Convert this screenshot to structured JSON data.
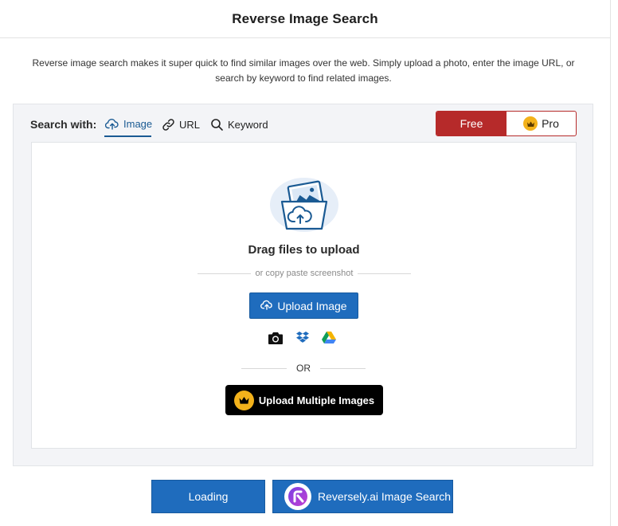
{
  "header": {
    "title": "Reverse Image Search"
  },
  "intro": {
    "text": "Reverse image search makes it super quick to find similar images over the web. Simply upload a photo, enter the image URL, or search by keyword to find related images."
  },
  "search": {
    "label": "Search with:",
    "tabs": [
      {
        "label": "Image",
        "icon": "cloud-upload-icon",
        "active": true
      },
      {
        "label": "URL",
        "icon": "link-icon",
        "active": false
      },
      {
        "label": "Keyword",
        "icon": "search-icon",
        "active": false
      }
    ]
  },
  "plan": {
    "free_label": "Free",
    "pro_label": "Pro",
    "active": "Free"
  },
  "upload": {
    "title": "Drag files to upload",
    "paste_hint": "or copy paste screenshot",
    "button_label": "Upload Image",
    "sources": [
      "camera-icon",
      "dropbox-icon",
      "google-drive-icon"
    ],
    "or_label": "OR",
    "multi_label": "Upload Multiple Images"
  },
  "footer": {
    "loading_label": "Loading",
    "reversely_label": "Reversely.ai Image Search"
  },
  "colors": {
    "accent_blue": "#1f6cbd",
    "free_red": "#b62a2a",
    "crown_gold": "#f3b21b",
    "tab_active": "#1a5a93"
  }
}
